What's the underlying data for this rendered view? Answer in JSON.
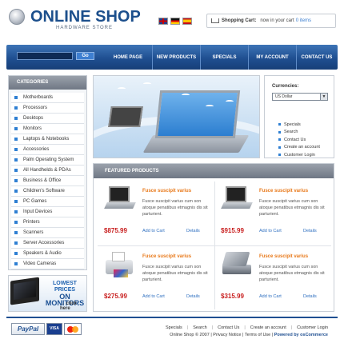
{
  "header": {
    "title": "ONLINE SHOP",
    "subtitle": "HARDWARE STORE",
    "flags": [
      "uk-flag-icon",
      "german-flag-icon",
      "spanish-flag-icon"
    ],
    "cart": {
      "title": "Shopping Cart:",
      "status": "now in your cart",
      "count": "0 items"
    }
  },
  "nav": {
    "search_button": "Go",
    "items": [
      "HOME PAGE",
      "NEW PRODUCTS",
      "SPECIALS",
      "MY ACCOUNT",
      "CONTACT US"
    ]
  },
  "categories": {
    "heading": "CATEGORIES",
    "items": [
      "Motherboards",
      "Processors",
      "Desktops",
      "Monitors",
      "Laptops & Notebooks",
      "Accessories",
      "Palm Operating System",
      "All Handhelds & PDAs",
      "Business & Office",
      "Children's Software",
      "PC Games",
      "Input Devices",
      "Printers",
      "Scanners",
      "Server Accessories",
      "Speakers & Audio",
      "Video Cameras"
    ]
  },
  "promo": {
    "line1": "LOWEST PRICES",
    "line2": "ON MONITORS",
    "click": "→ click here"
  },
  "currencies": {
    "label": "Currencies:",
    "selected": "US Dollar",
    "links": [
      "Specials",
      "Search",
      "Contact Us",
      "Create an account",
      "Customer Login"
    ]
  },
  "featured": {
    "heading": "FEATURED PRODUCTS",
    "products": [
      {
        "title": "Fusce suscipit varius",
        "desc": "Fusce suscipit varius cum son atoque penatibus etmagnis dis sit parturient.",
        "price": "$875.99",
        "cart": "Add to Cart",
        "details": "Details",
        "icon": "laptop-icon"
      },
      {
        "title": "Fusce suscipit varius",
        "desc": "Fusce suscipit varius cum son atoque penatibus etmagnis dis sit parturient.",
        "price": "$915.99",
        "cart": "Add to Cart",
        "details": "Details",
        "icon": "laptop-icon"
      },
      {
        "title": "Fusce suscipit varius",
        "desc": "Fusce suscipit varius cum son atoque penatibus etmagnis dis sit parturient.",
        "price": "$275.99",
        "cart": "Add to Cart",
        "details": "Details",
        "icon": "printer-icon"
      },
      {
        "title": "Fusce suscipit varius",
        "desc": "Fusce suscipit varius cum son atoque penatibus etmagnis dis sit parturient.",
        "price": "$315.99",
        "cart": "Add to Cart",
        "details": "Details",
        "icon": "scanner-icon"
      }
    ]
  },
  "footer": {
    "payments": {
      "paypal": "PayPal",
      "visa": "VISA",
      "mastercard": "mastercard-icon"
    },
    "links": [
      "Specials",
      "Search",
      "Contact Us",
      "Create an account",
      "Customer Login"
    ],
    "copyright": "Online Shop © 2007",
    "privacy": "Privacy Notice",
    "terms": "Terms of Use",
    "powered": "Powered by osCommerce"
  },
  "colors": {
    "brand_blue": "#1f4f91",
    "accent_orange": "#e87818",
    "price_red": "#c81e1e",
    "link_blue": "#2e6fc0"
  }
}
